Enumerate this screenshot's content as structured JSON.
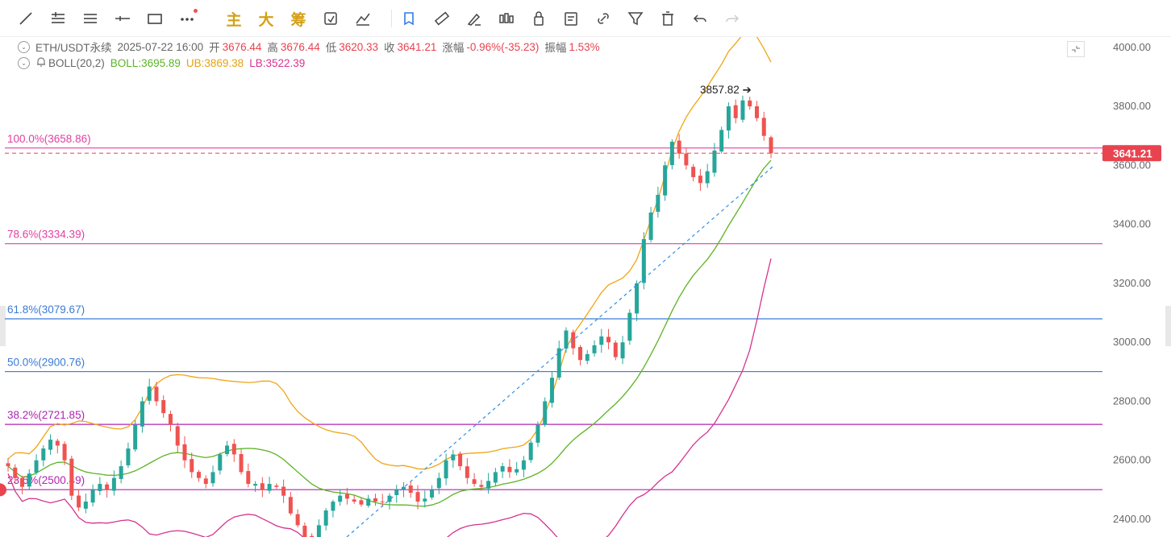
{
  "toolbar": {
    "tools": [
      {
        "name": "trend-line-icon"
      },
      {
        "name": "parallel-lines-icon"
      },
      {
        "name": "horizontal-lines-icon"
      },
      {
        "name": "horizontal-ray-icon"
      },
      {
        "name": "rectangle-icon"
      },
      {
        "name": "more-tools-icon"
      },
      {
        "name": "main-indicator-button",
        "label": "主"
      },
      {
        "name": "large-view-button",
        "label": "大"
      },
      {
        "name": "chips-button",
        "label": "筹"
      },
      {
        "name": "replay-icon"
      },
      {
        "name": "measure-icon"
      },
      {
        "name": "magnet-select-icon"
      },
      {
        "name": "ruler-icon"
      },
      {
        "name": "brush-icon"
      },
      {
        "name": "candle-pattern-icon"
      },
      {
        "name": "lock-icon"
      },
      {
        "name": "note-icon"
      },
      {
        "name": "link-icon"
      },
      {
        "name": "filter-icon"
      },
      {
        "name": "trash-icon"
      },
      {
        "name": "undo-icon"
      },
      {
        "name": "redo-icon"
      }
    ]
  },
  "legend": {
    "symbol": "ETH/USDT永续",
    "datetime": "2025-07-22 16:00",
    "open_label": "开",
    "open": "3676.44",
    "high_label": "高",
    "high": "3676.44",
    "low_label": "低",
    "low": "3620.33",
    "close_label": "收",
    "close": "3641.21",
    "change_label": "涨幅",
    "change": "-0.96%(-35.23)",
    "amplitude_label": "振幅",
    "amplitude": "1.53%",
    "boll_label": "BOLL(20,2)",
    "boll_mid": "BOLL:3695.89",
    "boll_ub": "UB:3869.38",
    "boll_lb": "LB:3522.39"
  },
  "colors": {
    "up": "#26a69a",
    "down": "#ef5350",
    "boll_mid": "#5cb325",
    "boll_ub": "#f0a515",
    "boll_lb": "#d6338f",
    "price_tag": "#e8434f",
    "trend_line": "#2f8fe8"
  },
  "chart_data": {
    "type": "candlestick",
    "ylim": [
      2340,
      4035
    ],
    "y_ticks": [
      "4000.00",
      "3800.00",
      "3600.00",
      "3400.00",
      "3200.00",
      "3000.00",
      "2800.00",
      "2600.00",
      "2400.00"
    ],
    "y_tick_values": [
      4000,
      3800,
      3600,
      3400,
      3200,
      3000,
      2800,
      2600,
      2400
    ],
    "last_price": 3641.21,
    "last_price_label": "3641.21",
    "max_annotation": {
      "label": "3857.82",
      "value": 3857.82
    },
    "fib_levels": [
      {
        "label": "100.0%(3658.86)",
        "value": 3658.86,
        "color": "#e040a0"
      },
      {
        "label": "78.6%(3334.39)",
        "value": 3334.39,
        "color": "#e040a0"
      },
      {
        "label": "61.8%(3079.67)",
        "value": 3079.67,
        "color": "#3a7bd5"
      },
      {
        "label": "50.0%(2900.76)",
        "value": 2900.76,
        "color": "#3a7bd5"
      },
      {
        "label": "38.2%(2721.85)",
        "value": 2721.85,
        "color": "#b024b0"
      },
      {
        "label": "23.6%(2500.49)",
        "value": 2500.49,
        "color": "#b024b0"
      }
    ],
    "trend_line": {
      "from": 2340,
      "to": 3600
    },
    "closes": [
      2580,
      2540,
      2510,
      2555,
      2600,
      2640,
      2670,
      2650,
      2600,
      2480,
      2440,
      2460,
      2500,
      2520,
      2500,
      2540,
      2580,
      2640,
      2720,
      2800,
      2850,
      2800,
      2760,
      2720,
      2650,
      2600,
      2560,
      2540,
      2520,
      2560,
      2620,
      2650,
      2620,
      2560,
      2520,
      2520,
      2500,
      2520,
      2510,
      2480,
      2420,
      2380,
      2340,
      2320,
      2380,
      2430,
      2460,
      2480,
      2470,
      2460,
      2450,
      2470,
      2460,
      2460,
      2480,
      2500,
      2510,
      2490,
      2460,
      2470,
      2500,
      2540,
      2600,
      2620,
      2580,
      2540,
      2520,
      2510,
      2530,
      2560,
      2580,
      2560,
      2570,
      2600,
      2660,
      2720,
      2800,
      2880,
      2980,
      3040,
      2980,
      2940,
      2960,
      2990,
      3020,
      3000,
      2950,
      3000,
      3100,
      3200,
      3350,
      3440,
      3500,
      3600,
      3680,
      3640,
      3600,
      3560,
      3540,
      3580,
      3650,
      3720,
      3800,
      3760,
      3820,
      3800,
      3760,
      3700,
      3641
    ]
  }
}
